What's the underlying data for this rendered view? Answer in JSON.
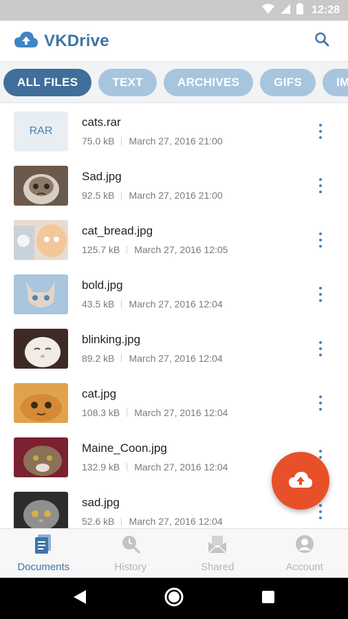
{
  "status_bar": {
    "time": "12:28"
  },
  "app": {
    "title": "VKDrive"
  },
  "colors": {
    "accent": "#3f75a6",
    "chip_inactive": "#a7c5de",
    "chip_active": "#3f6f9a",
    "fab": "#e8502a"
  },
  "filters": [
    {
      "label": "ALL FILES",
      "active": true
    },
    {
      "label": "TEXT",
      "active": false
    },
    {
      "label": "ARCHIVES",
      "active": false
    },
    {
      "label": "GIFS",
      "active": false
    },
    {
      "label": "IMAGES",
      "active": false
    }
  ],
  "files": [
    {
      "name": "cats.rar",
      "size": "75.0 kB",
      "date": "March 27, 2016 21:00",
      "thumb_label": "RAR"
    },
    {
      "name": "Sad.jpg",
      "size": "92.5 kB",
      "date": "March 27, 2016 21:00"
    },
    {
      "name": "cat_bread.jpg",
      "size": "125.7 kB",
      "date": "March 27, 2016 12:05"
    },
    {
      "name": "bold.jpg",
      "size": "43.5 kB",
      "date": "March 27, 2016 12:04"
    },
    {
      "name": "blinking.jpg",
      "size": "89.2 kB",
      "date": "March 27, 2016 12:04"
    },
    {
      "name": "cat.jpg",
      "size": "108.3 kB",
      "date": "March 27, 2016 12:04"
    },
    {
      "name": "Maine_Coon.jpg",
      "size": "132.9 kB",
      "date": "March 27, 2016 12:04"
    },
    {
      "name": "sad.jpg",
      "size": "52.6 kB",
      "date": "March 27, 2016 12:04"
    }
  ],
  "bottom_nav": [
    {
      "label": "Documents",
      "icon": "document-icon",
      "active": true
    },
    {
      "label": "History",
      "icon": "history-icon",
      "active": false
    },
    {
      "label": "Shared",
      "icon": "shared-icon",
      "active": false
    },
    {
      "label": "Account",
      "icon": "account-icon",
      "active": false
    }
  ]
}
